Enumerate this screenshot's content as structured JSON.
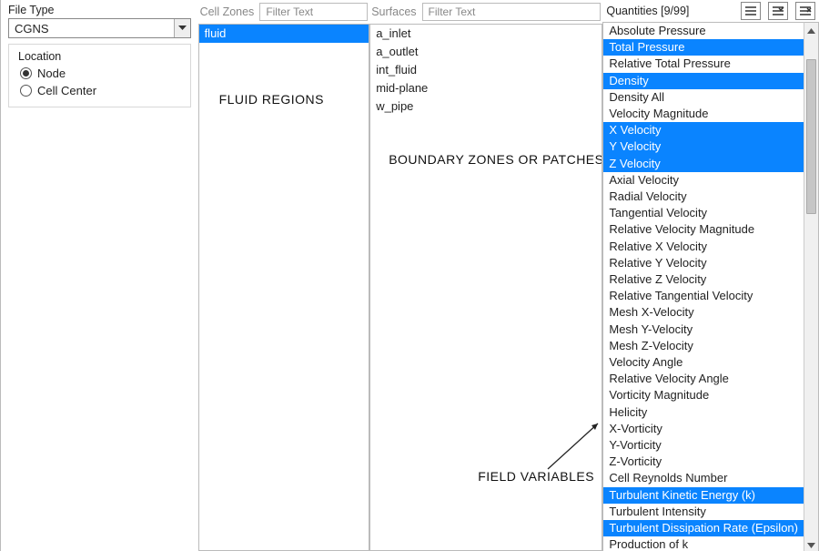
{
  "left": {
    "file_type_label": "File Type",
    "file_type_value": "CGNS",
    "location_label": "Location",
    "radio_node": "Node",
    "radio_cellcenter": "Cell Center",
    "location_selected": "Node"
  },
  "cell_zones": {
    "header": "Cell Zones",
    "filter_placeholder": "Filter Text",
    "items": [
      {
        "label": "fluid",
        "selected": true
      }
    ]
  },
  "surfaces": {
    "header": "Surfaces",
    "filter_placeholder": "Filter Text",
    "items": [
      {
        "label": "a_inlet"
      },
      {
        "label": "a_outlet"
      },
      {
        "label": "int_fluid"
      },
      {
        "label": "mid-plane"
      },
      {
        "label": "w_pipe"
      }
    ]
  },
  "quantities": {
    "title": "Quantities  [9/99]",
    "items": [
      {
        "label": "Absolute Pressure"
      },
      {
        "label": "Total Pressure",
        "selected": true
      },
      {
        "label": "Relative Total Pressure"
      },
      {
        "label": "Density",
        "selected": true
      },
      {
        "label": "Density All"
      },
      {
        "label": "Velocity Magnitude"
      },
      {
        "label": "X Velocity",
        "selected": true
      },
      {
        "label": "Y Velocity",
        "selected": true
      },
      {
        "label": "Z Velocity",
        "selected": true
      },
      {
        "label": "Axial Velocity"
      },
      {
        "label": "Radial Velocity"
      },
      {
        "label": "Tangential Velocity"
      },
      {
        "label": "Relative Velocity Magnitude"
      },
      {
        "label": "Relative X Velocity"
      },
      {
        "label": "Relative Y Velocity"
      },
      {
        "label": "Relative Z Velocity"
      },
      {
        "label": "Relative Tangential Velocity"
      },
      {
        "label": "Mesh X-Velocity"
      },
      {
        "label": "Mesh Y-Velocity"
      },
      {
        "label": "Mesh Z-Velocity"
      },
      {
        "label": "Velocity Angle"
      },
      {
        "label": "Relative Velocity Angle"
      },
      {
        "label": "Vorticity Magnitude"
      },
      {
        "label": "Helicity"
      },
      {
        "label": "X-Vorticity"
      },
      {
        "label": "Y-Vorticity"
      },
      {
        "label": "Z-Vorticity"
      },
      {
        "label": "Cell Reynolds Number"
      },
      {
        "label": "Turbulent Kinetic Energy (k)",
        "selected": true
      },
      {
        "label": "Turbulent Intensity"
      },
      {
        "label": "Turbulent Dissipation Rate (Epsilon)",
        "selected": true
      },
      {
        "label": "Production of k"
      }
    ]
  },
  "annotations": {
    "fluid_regions": "FLUID REGIONS",
    "boundary": "BOUNDARY ZONES OR PATCHES",
    "field_vars": "FIELD VARIABLES"
  }
}
